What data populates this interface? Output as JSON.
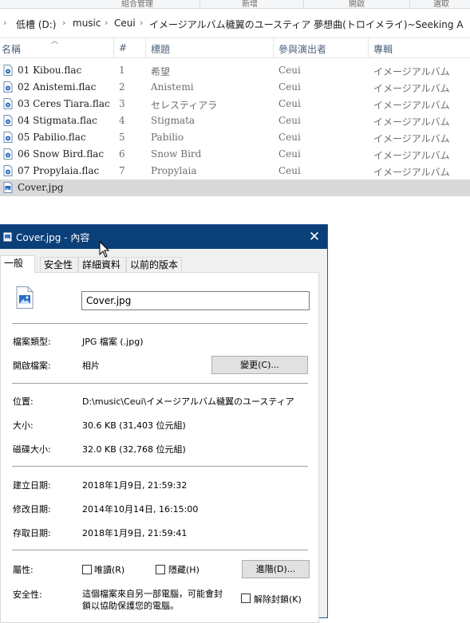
{
  "ribbon": {
    "groups": [
      "組合管理",
      "新增",
      "開啟",
      "選取"
    ]
  },
  "address": {
    "crumbs": [
      "低槽 (D:)",
      "music",
      "Ceui",
      "イメージアルバム穢翼のユースティア 夢想曲(トロイメライ)~Seeking A"
    ]
  },
  "columns": {
    "name": "名稱",
    "number": "#",
    "title": "標題",
    "artist": "參與演出者",
    "album": "專輯"
  },
  "files": [
    {
      "icon": "audio-file-icon",
      "name": "01 Kibou.flac",
      "number": "1",
      "title": "希望",
      "artist": "Ceui",
      "album": "イメージアルバム"
    },
    {
      "icon": "audio-file-icon",
      "name": "02 Anistemi.flac",
      "number": "2",
      "title": "Anistemi",
      "artist": "Ceui",
      "album": "イメージアルバム"
    },
    {
      "icon": "audio-file-icon",
      "name": "03 Ceres Tiara.flac",
      "number": "3",
      "title": "セレスティアラ",
      "artist": "Ceui",
      "album": "イメージアルバム"
    },
    {
      "icon": "audio-file-icon",
      "name": "04 Stigmata.flac",
      "number": "4",
      "title": "Stigmata",
      "artist": "Ceui",
      "album": "イメージアルバム"
    },
    {
      "icon": "audio-file-icon",
      "name": "05 Pabilio.flac",
      "number": "5",
      "title": "Pabilio",
      "artist": "Ceui",
      "album": "イメージアルバム"
    },
    {
      "icon": "audio-file-icon",
      "name": "06 Snow Bird.flac",
      "number": "6",
      "title": "Snow Bird",
      "artist": "Ceui",
      "album": "イメージアルバム"
    },
    {
      "icon": "audio-file-icon",
      "name": "07 Propylaia.flac",
      "number": "7",
      "title": "Propylaia",
      "artist": "Ceui",
      "album": "イメージアルバム"
    },
    {
      "icon": "image-file-icon",
      "name": "Cover.jpg",
      "number": "",
      "title": "",
      "artist": "",
      "album": "",
      "selected": true
    }
  ],
  "dialog": {
    "title": "Cover.jpg - 內容",
    "close_label": "✕",
    "tabs": [
      "一般",
      "安全性",
      "詳細資料",
      "以前的版本"
    ],
    "filename": "Cover.jpg",
    "type_label": "檔案類型:",
    "type_value": "JPG 檔案 (.jpg)",
    "opens_label": "開啟檔案:",
    "opens_value": "相片",
    "change_button": "變更(C)...",
    "location_label": "位置:",
    "location_value": "D:\\music\\Ceui\\イメージアルバム穢翼のユースティア",
    "size_label": "大小:",
    "size_value": "30.6 KB (31,403 位元組)",
    "disk_label": "磁碟大小:",
    "disk_value": "32.0 KB (32,768 位元組)",
    "created_label": "建立日期:",
    "created_value": "2018年1月9日, 21:59:32",
    "modified_label": "修改日期:",
    "modified_value": "2014年10月14日, 16:15:00",
    "accessed_label": "存取日期:",
    "accessed_value": "2018年1月9日, 21:59:41",
    "attributes_label": "屬性:",
    "readonly_label": "唯讀(R)",
    "hidden_label": "隱藏(H)",
    "advanced_button": "進階(D)...",
    "security_label": "安全性:",
    "security_text_1": "這個檔案來自另一部電腦，可能會封",
    "security_text_2": "鎖以協助保護您的電腦。",
    "unblock_label": "解除封鎖(K)"
  },
  "colors": {
    "titlebar": "#0b3f79",
    "selected_row": "#d9d9d9",
    "header_text": "#4c607a"
  }
}
